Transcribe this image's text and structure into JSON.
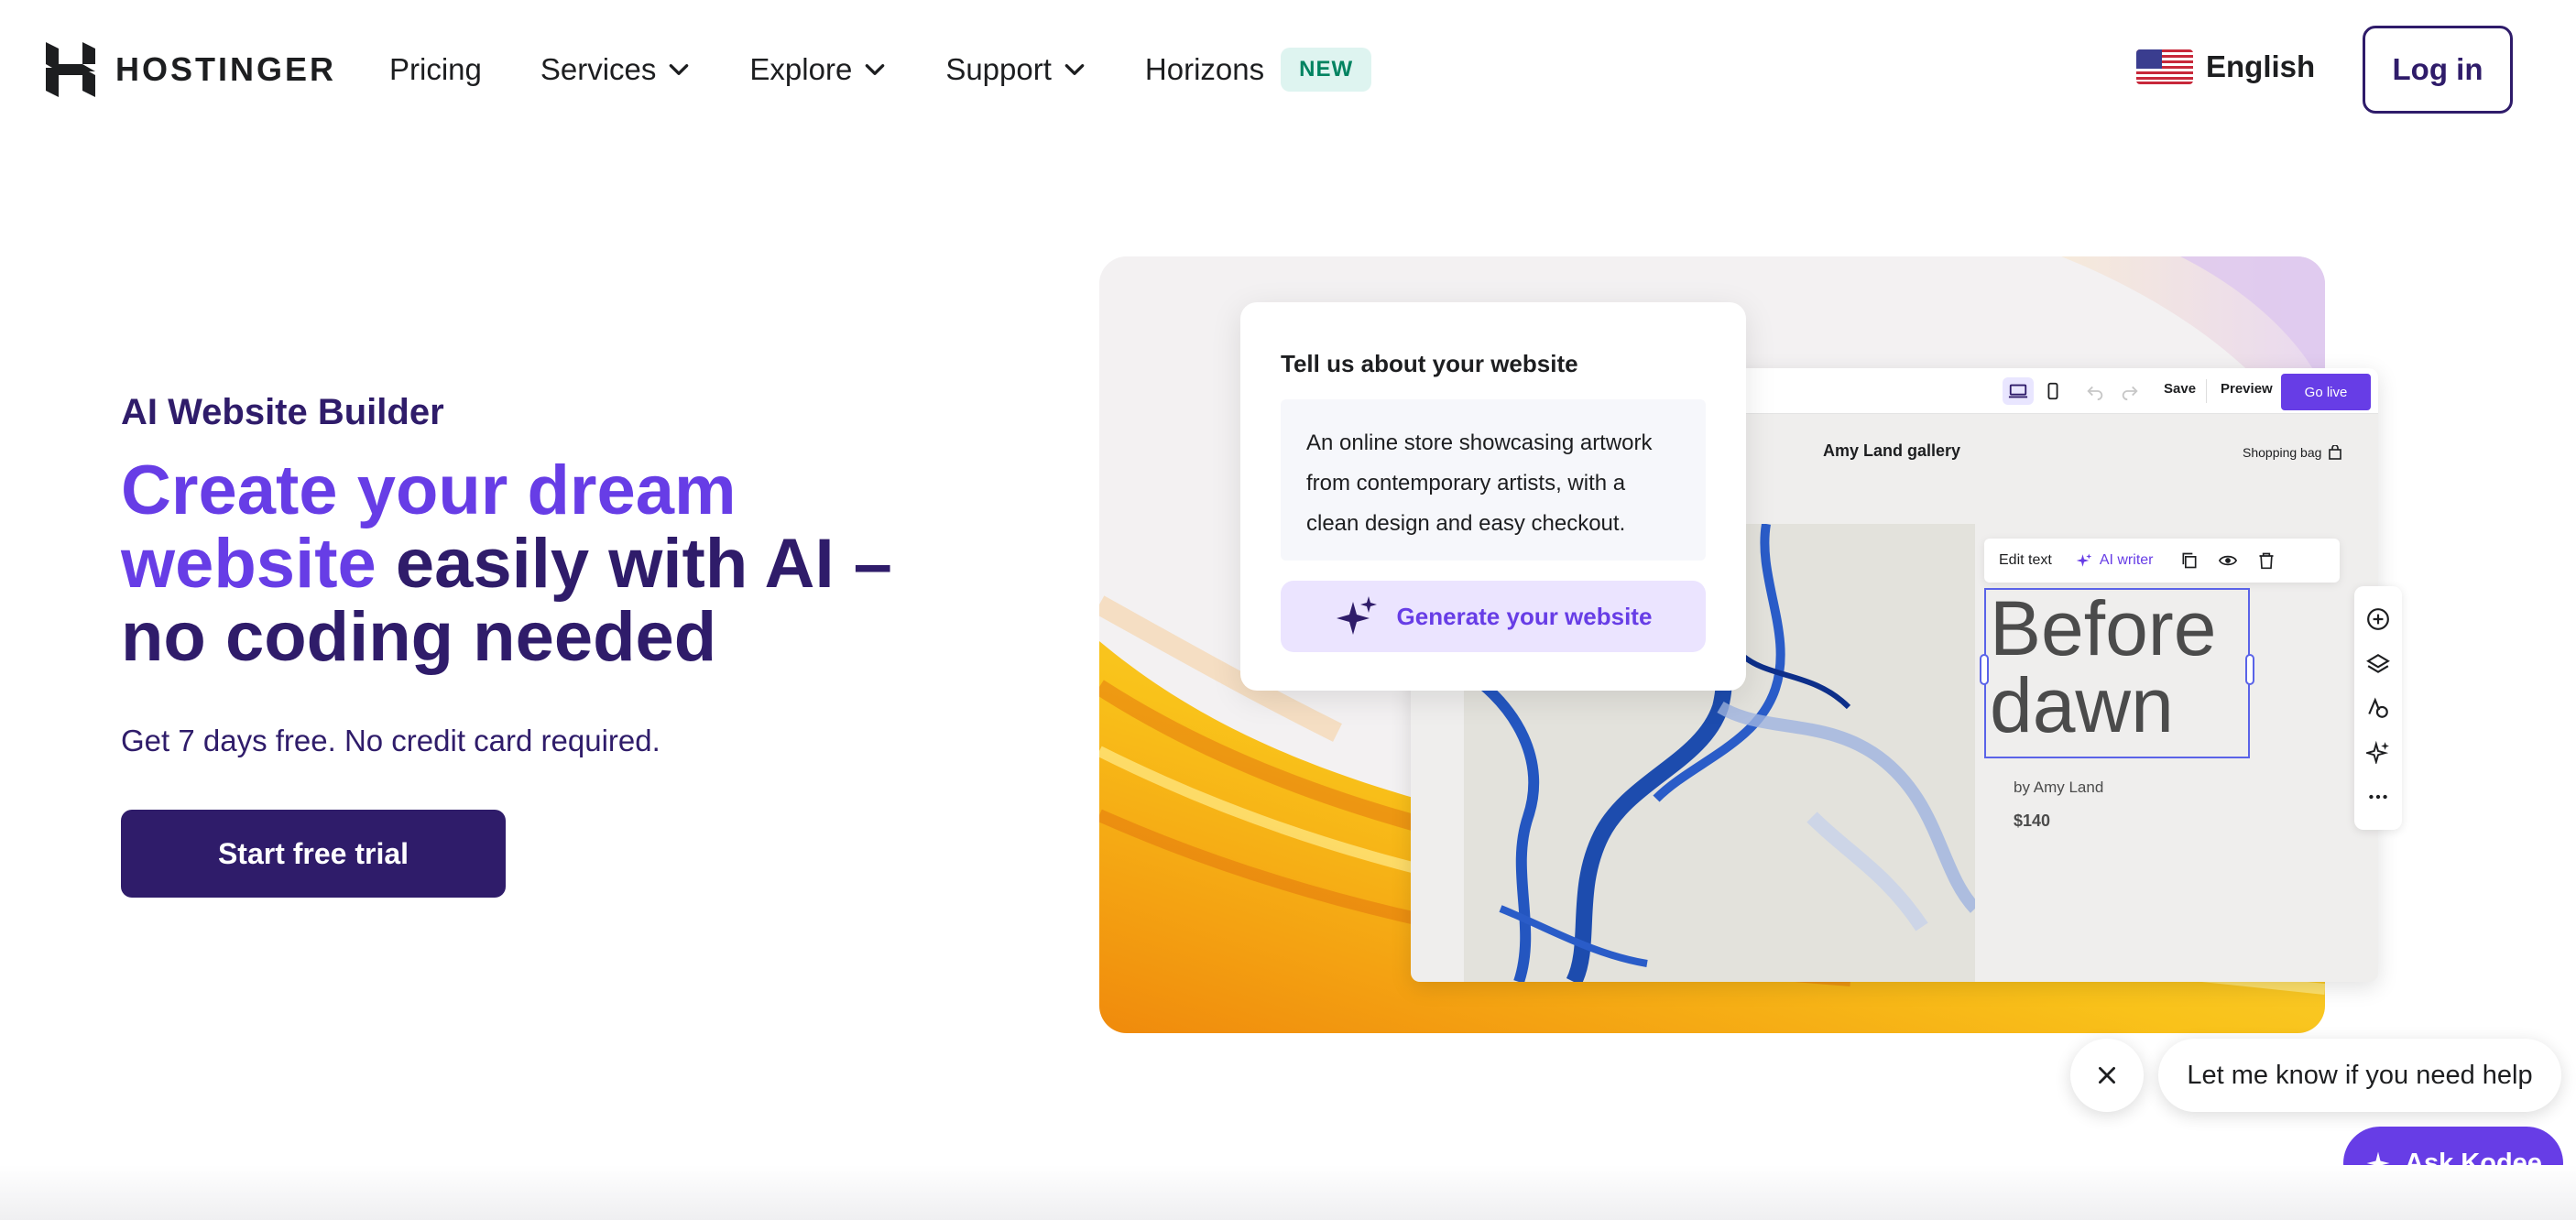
{
  "brand": {
    "name": "HOSTINGER",
    "logo_icon": "hostinger-logo-icon",
    "primary_color": "#673de6",
    "dark_color": "#2f1c6a"
  },
  "nav": {
    "items": [
      {
        "label": "Pricing",
        "has_dropdown": false
      },
      {
        "label": "Services",
        "has_dropdown": true
      },
      {
        "label": "Explore",
        "has_dropdown": true
      },
      {
        "label": "Support",
        "has_dropdown": true
      },
      {
        "label": "Horizons",
        "has_dropdown": false
      }
    ],
    "horizons_badge": "NEW",
    "language": {
      "label": "English",
      "icon": "us-flag-icon"
    },
    "login_label": "Log in"
  },
  "hero": {
    "eyebrow": "AI Website Builder",
    "headline_accent": "Create your dream website",
    "headline_rest": " easily with AI – no coding needed",
    "subtext": "Get 7 days free. No credit card required.",
    "cta_label": "Start free trial"
  },
  "prompt_card": {
    "title": "Tell us about your website",
    "prompt_text": "An online store showcasing artwork from contemporary artists, with a clean design and easy checkout.",
    "button_label": "Generate your website",
    "button_icon": "sparkles-icon"
  },
  "editor": {
    "toolbar": {
      "save_label": "Save",
      "preview_label": "Preview",
      "go_live_label": "Go live"
    },
    "site_name": "Amy Land gallery",
    "shopping_bag_label": "Shopping bag",
    "context_bar": {
      "edit_text_label": "Edit text",
      "ai_writer_label": "AI writer"
    },
    "artwork_title": "Before dawn",
    "artwork_author": "by Amy Land",
    "artwork_price": "$140"
  },
  "chat": {
    "bubble_text": "Let me know if you need help",
    "ask_label": "Ask Kodee"
  }
}
